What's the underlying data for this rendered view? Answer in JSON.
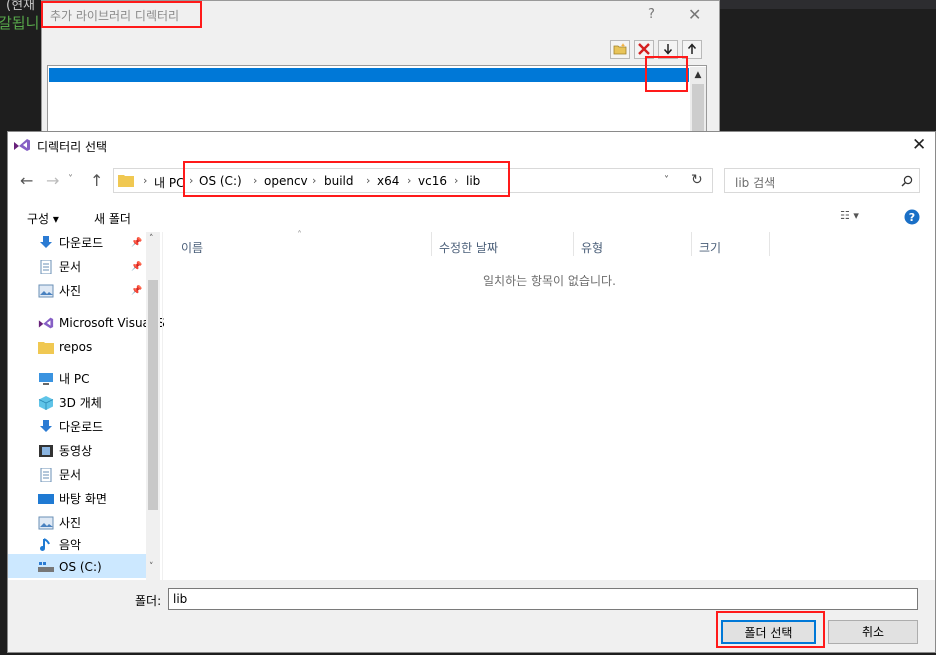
{
  "background": {
    "line1": "(현재",
    "line2": "갈됩니"
  },
  "add_dir_dialog": {
    "title": "추가 라이브러리 디렉터리",
    "help": "?",
    "close": "✕",
    "toolbar_icons": [
      "new-folder-icon",
      "delete-icon",
      "move-down-icon",
      "move-up-icon"
    ]
  },
  "dialog": {
    "title": "디렉터리 선택",
    "close": "✕",
    "address": {
      "root": "내 PC",
      "path": [
        "OS (C:)",
        "opencv",
        "build",
        "x64",
        "vc16",
        "lib"
      ]
    },
    "search_placeholder": "lib 검색",
    "commands": {
      "organize": "구성 ▾",
      "new_folder": "새 폴더"
    },
    "nav_items": [
      {
        "label": "다운로드",
        "icon": "download-icon",
        "pinned": true
      },
      {
        "label": "문서",
        "icon": "document-icon",
        "pinned": true
      },
      {
        "label": "사진",
        "icon": "picture-icon",
        "pinned": true
      },
      {
        "label": "Microsoft Visual S",
        "icon": "visual-studio-icon"
      },
      {
        "label": "repos",
        "icon": "folder-icon"
      },
      {
        "label": "내 PC",
        "icon": "computer-icon"
      },
      {
        "label": "3D 개체",
        "icon": "3d-objects-icon"
      },
      {
        "label": "다운로드",
        "icon": "download-icon"
      },
      {
        "label": "동영상",
        "icon": "video-icon"
      },
      {
        "label": "문서",
        "icon": "document-icon"
      },
      {
        "label": "바탕 화면",
        "icon": "desktop-icon"
      },
      {
        "label": "사진",
        "icon": "picture-icon"
      },
      {
        "label": "음악",
        "icon": "music-icon"
      },
      {
        "label": "OS (C:)",
        "icon": "drive-icon",
        "selected": true
      }
    ],
    "columns": [
      "이름",
      "수정한 날짜",
      "유형",
      "크기"
    ],
    "empty_message": "일치하는 항목이 없습니다.",
    "folder_label": "폴더:",
    "folder_value": "lib",
    "select_button": "폴더 선택",
    "cancel_button": "취소"
  }
}
